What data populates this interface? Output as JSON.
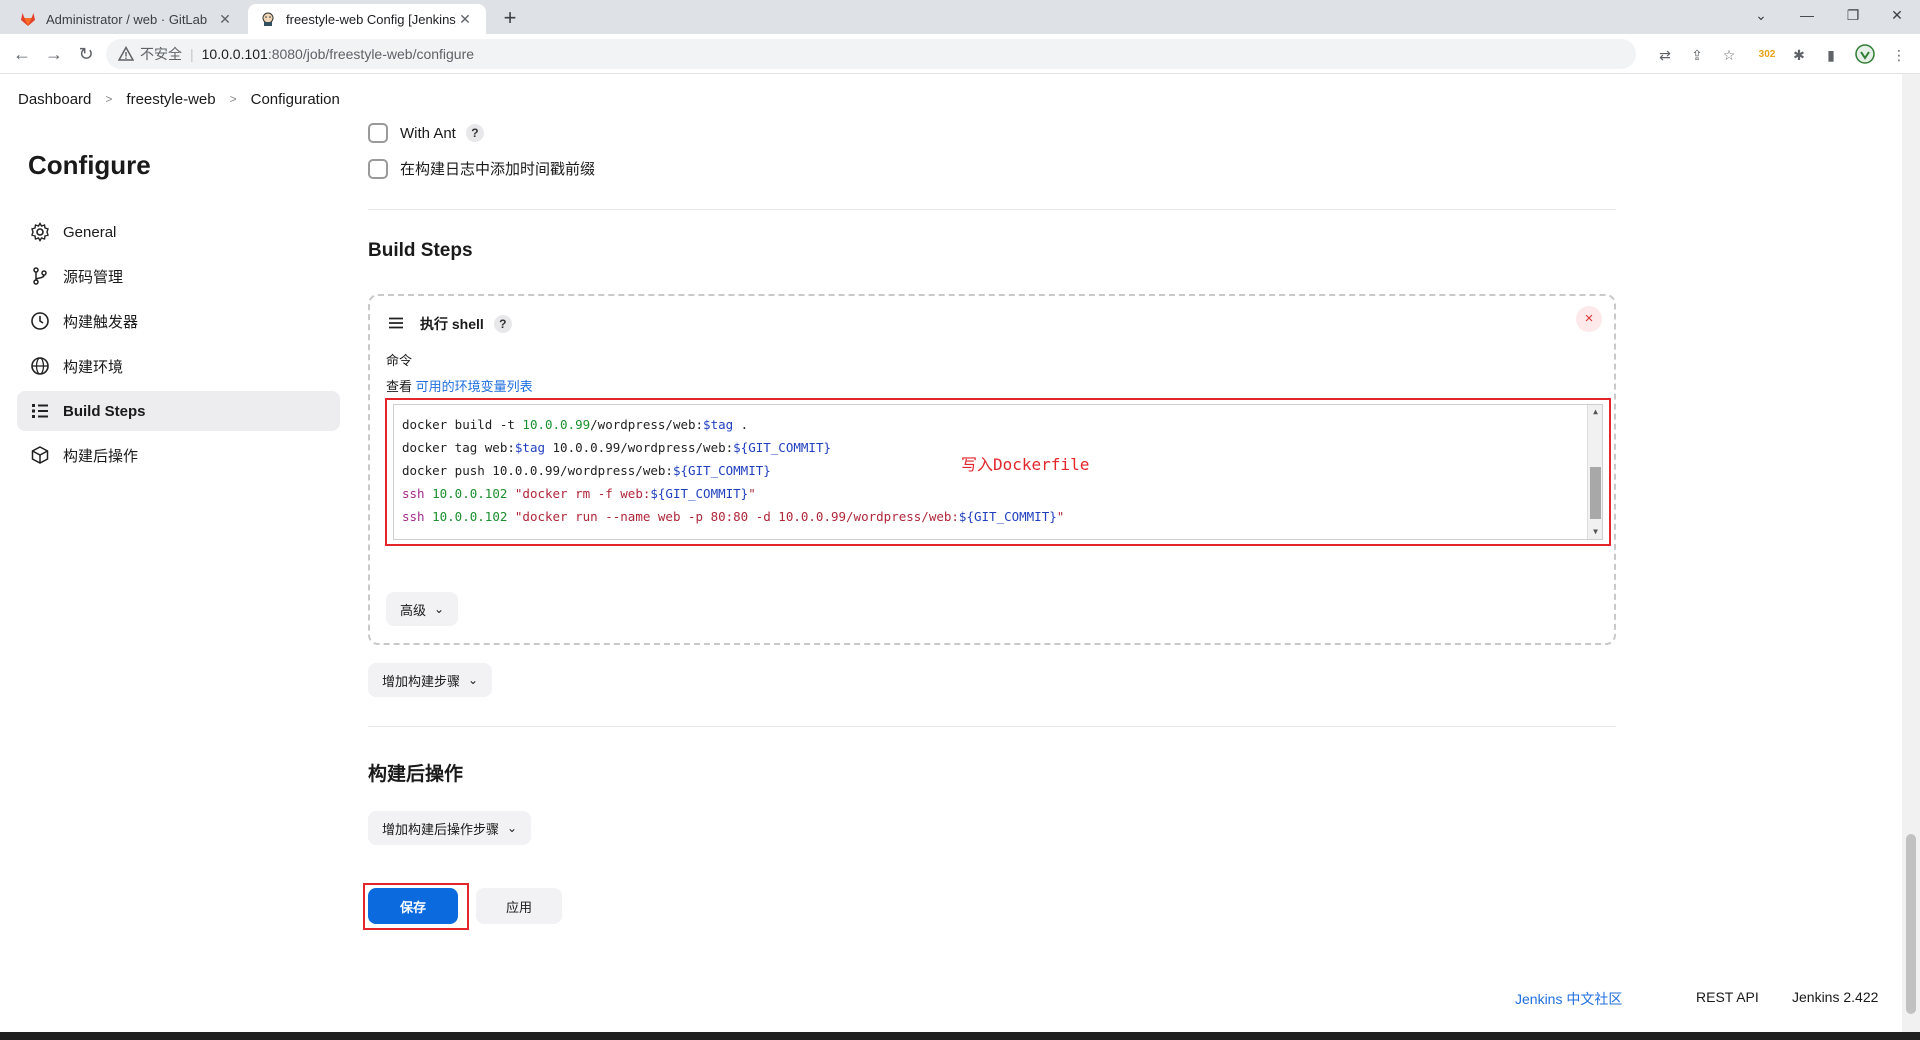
{
  "browser": {
    "tabs": [
      {
        "title": "Administrator / web · GitLab",
        "icon": "gitlab-icon",
        "active": false
      },
      {
        "title": "freestyle-web Config [Jenkins]",
        "icon": "jenkins-icon",
        "active": true
      }
    ],
    "address": {
      "insecure_label": "不安全",
      "host": "10.0.0.101",
      "path": ":8080/job/freestyle-web/configure"
    },
    "ext_badge": "302"
  },
  "breadcrumb": [
    "Dashboard",
    "freestyle-web",
    "Configuration"
  ],
  "sidebar": {
    "title": "Configure",
    "items": [
      {
        "label": "General",
        "icon": "gear-icon"
      },
      {
        "label": "源码管理",
        "icon": "git-branch-icon"
      },
      {
        "label": "构建触发器",
        "icon": "clock-icon"
      },
      {
        "label": "构建环境",
        "icon": "globe-icon"
      },
      {
        "label": "Build Steps",
        "icon": "list-icon",
        "active": true
      },
      {
        "label": "构建后操作",
        "icon": "package-icon"
      }
    ]
  },
  "options": [
    {
      "label": "With Ant",
      "help": "?"
    },
    {
      "label": "在构建日志中添加时间戳前缀"
    }
  ],
  "build_steps": {
    "title": "Build Steps",
    "step": {
      "title": "执行 shell",
      "help": "?",
      "delete": "×",
      "command_label": "命令",
      "env_prefix": "查看 ",
      "env_link": "可用的环境变量列表",
      "code_lines": [
        "docker build -t 10.0.0.99/wordpress/web:$tag .",
        "docker tag web:$tag 10.0.0.99/wordpress/web:${GIT_COMMIT}",
        "docker push 10.0.0.99/wordpress/web:${GIT_COMMIT}",
        "ssh 10.0.0.102 \"docker rm -f web:${GIT_COMMIT}\"",
        "ssh 10.0.0.102 \"docker run --name web -p 80:80 -d 10.0.0.99/wordpress/web:${GIT_COMMIT}\""
      ],
      "annotation": "写入Dockerfile",
      "advanced": "高级"
    },
    "add_step": "增加构建步骤"
  },
  "post_build": {
    "title": "构建后操作",
    "add_step": "增加构建后操作步骤"
  },
  "actions": {
    "save": "保存",
    "apply": "应用"
  },
  "footer": {
    "community": "Jenkins 中文社区",
    "rest_api": "REST API",
    "version": "Jenkins 2.422"
  },
  "colors": {
    "accent": "#0b6bde",
    "annotation": "#e2262b",
    "link": "#1f6fde"
  }
}
